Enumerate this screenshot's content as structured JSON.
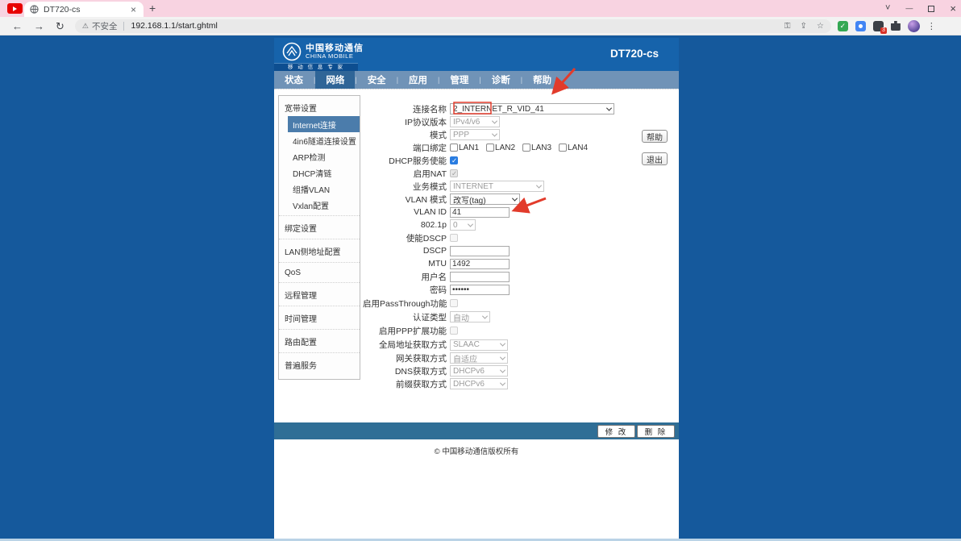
{
  "browser": {
    "tab_title": "DT720-cs",
    "icons": {
      "close": "×",
      "plus": "+",
      "chevron_down": "˅",
      "minimize": "—",
      "back": "←",
      "forward": "→",
      "reload": "↻",
      "warning": "⚠",
      "key": "⚿",
      "share": "⇪",
      "star": "☆",
      "dots": "⋮",
      "shield_check": "✓"
    },
    "address": {
      "security_text": "不安全",
      "url": "192.168.1.1/start.ghtml"
    },
    "extension_badge": "3"
  },
  "header": {
    "brand_cn": "中国移动通信",
    "brand_en": "CHINA MOBILE",
    "tagline": "移 动 信 息 专 家",
    "device": "DT720-cs"
  },
  "nav": {
    "items": [
      "状态",
      "网络",
      "安全",
      "应用",
      "管理",
      "诊断",
      "帮助"
    ],
    "active": "网络"
  },
  "sidebar": {
    "sections": [
      {
        "title": "宽带设置",
        "items": [
          "Internet连接",
          "4in6隧道连接设置",
          "ARP检测",
          "DHCP清链",
          "组播VLAN",
          "Vxlan配置"
        ],
        "active": "Internet连接"
      },
      {
        "title": "绑定设置"
      },
      {
        "title": "LAN侧地址配置"
      },
      {
        "title": "QoS"
      },
      {
        "title": "远程管理"
      },
      {
        "title": "时间管理"
      },
      {
        "title": "路由配置"
      },
      {
        "title": "普遍服务"
      }
    ]
  },
  "form": {
    "rows": [
      {
        "label": "连接名称",
        "type": "select",
        "value": "2_INTERNET_R_VID_41",
        "state": "enabled"
      },
      {
        "label": "IP协议版本",
        "type": "select",
        "value": "IPv4/v6",
        "state": "disabled"
      },
      {
        "label": "模式",
        "type": "select",
        "value": "PPP",
        "state": "disabled"
      },
      {
        "label": "端口绑定",
        "type": "checkbox-group",
        "options": [
          "LAN1",
          "LAN2",
          "LAN3",
          "LAN4"
        ],
        "checked": []
      },
      {
        "label": "DHCP服务使能",
        "type": "checkbox",
        "checked": true,
        "state": "enabled"
      },
      {
        "label": "启用NAT",
        "type": "checkbox",
        "checked": true,
        "state": "disabled"
      },
      {
        "label": "业务模式",
        "type": "select",
        "value": "INTERNET",
        "state": "disabled"
      },
      {
        "label": "VLAN 模式",
        "type": "select",
        "value": "改写(tag)",
        "state": "enabled"
      },
      {
        "label": "VLAN ID",
        "type": "input",
        "value": "41",
        "state": "enabled"
      },
      {
        "label": "802.1p",
        "type": "select",
        "value": "0",
        "state": "disabled"
      },
      {
        "label": "使能DSCP",
        "type": "checkbox",
        "checked": false,
        "state": "disabled"
      },
      {
        "label": "DSCP",
        "type": "input",
        "value": "",
        "state": "enabled"
      },
      {
        "label": "MTU",
        "type": "input",
        "value": "1492",
        "state": "enabled"
      },
      {
        "label": "用户名",
        "type": "input",
        "value": "",
        "state": "enabled"
      },
      {
        "label": "密码",
        "type": "password",
        "value": "••••••",
        "state": "enabled"
      },
      {
        "label": "启用PassThrough功能",
        "type": "checkbox",
        "checked": false,
        "state": "disabled"
      },
      {
        "label": "认证类型",
        "type": "select",
        "value": "自动",
        "state": "disabled"
      },
      {
        "label": "启用PPP扩展功能",
        "type": "checkbox",
        "checked": false,
        "state": "disabled"
      },
      {
        "label": "全局地址获取方式",
        "type": "select",
        "value": "SLAAC",
        "state": "disabled"
      },
      {
        "label": "网关获取方式",
        "type": "select",
        "value": "自适应",
        "state": "disabled"
      },
      {
        "label": "DNS获取方式",
        "type": "select",
        "value": "DHCPv6",
        "state": "disabled"
      },
      {
        "label": "前缀获取方式",
        "type": "select",
        "value": "DHCPv6",
        "state": "disabled"
      }
    ]
  },
  "buttons": {
    "help": "帮助",
    "exit": "退出",
    "modify": "修 改",
    "delete": "删 除"
  },
  "footer": "© 中国移动通信版权所有",
  "annotation_color": "#e23b2b"
}
